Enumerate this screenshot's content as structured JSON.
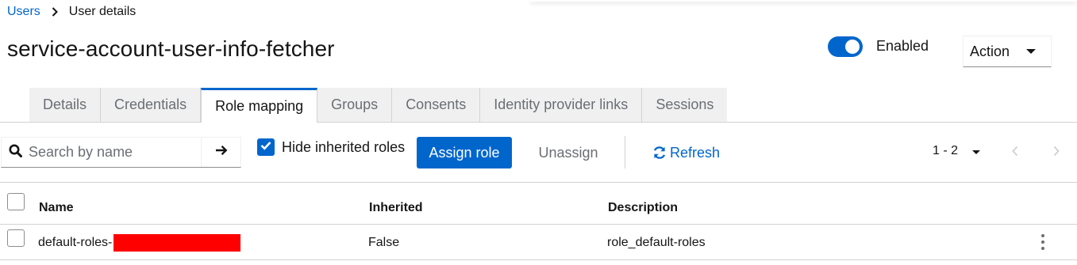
{
  "breadcrumb": {
    "parent": "Users",
    "current": "User details"
  },
  "page": {
    "title": "service-account-user-info-fetcher"
  },
  "header": {
    "enabled_label": "Enabled",
    "enabled": true,
    "action_label": "Action"
  },
  "tabs": [
    {
      "label": "Details"
    },
    {
      "label": "Credentials"
    },
    {
      "label": "Role mapping",
      "active": true
    },
    {
      "label": "Groups"
    },
    {
      "label": "Consents"
    },
    {
      "label": "Identity provider links"
    },
    {
      "label": "Sessions"
    }
  ],
  "toolbar": {
    "search_placeholder": "Search by name",
    "hide_inherited_label": "Hide inherited roles",
    "hide_inherited_checked": true,
    "assign_label": "Assign role",
    "unassign_label": "Unassign",
    "refresh_label": "Refresh",
    "pagination_range": "1 - 2"
  },
  "table": {
    "columns": [
      "Name",
      "Inherited",
      "Description"
    ],
    "rows": [
      {
        "name": "default-roles-",
        "inherited": "False",
        "description": "role_default-roles"
      }
    ]
  },
  "colors": {
    "accent": "#0066cc",
    "redaction": "#ff0000"
  },
  "icons": [
    "chevron-right-icon",
    "search-icon",
    "arrow-right-icon",
    "check-icon",
    "sync-icon",
    "chevron-left-icon",
    "kebab-icon"
  ]
}
